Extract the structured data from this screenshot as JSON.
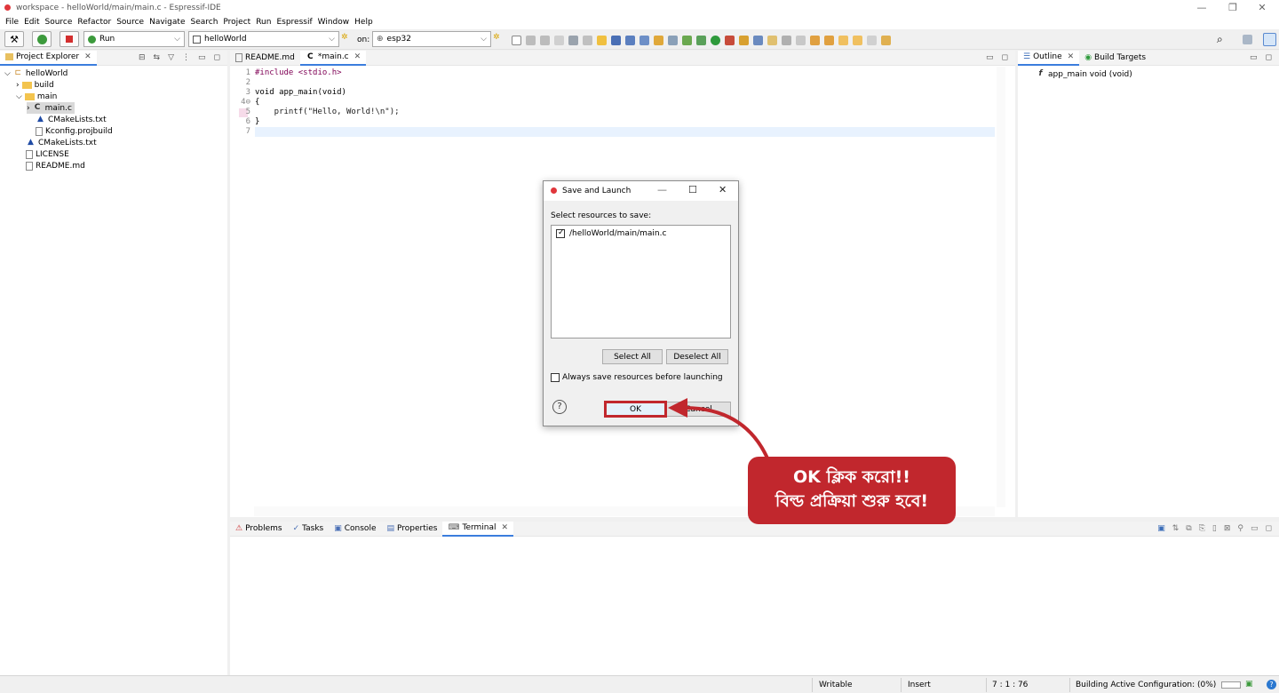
{
  "window": {
    "title": "workspace - helloWorld/main/main.c - Espressif-IDE",
    "controls": [
      "—",
      "❐",
      "✕"
    ]
  },
  "menu": [
    "File",
    "Edit",
    "Source",
    "Refactor",
    "Source",
    "Navigate",
    "Search",
    "Project",
    "Run",
    "Espressif",
    "Window",
    "Help"
  ],
  "toolbar": {
    "launch_mode": "Run",
    "launch_config": "helloWorld",
    "on_label": "on:",
    "target": "esp32"
  },
  "project_explorer": {
    "tab_label": "Project Explorer",
    "items": [
      {
        "label": "helloWorld",
        "icon": "project-icon"
      },
      {
        "label": "build",
        "icon": "folder-icon"
      },
      {
        "label": "main",
        "icon": "folder-icon"
      },
      {
        "label": "main.c",
        "icon": "c-file-icon"
      },
      {
        "label": "CMakeLists.txt",
        "icon": "cmake-icon"
      },
      {
        "label": "Kconfig.projbuild",
        "icon": "file-icon"
      },
      {
        "label": "CMakeLists.txt",
        "icon": "cmake-icon"
      },
      {
        "label": "LICENSE",
        "icon": "license-icon"
      },
      {
        "label": "README.md",
        "icon": "file-icon"
      }
    ]
  },
  "editor": {
    "tabs": [
      {
        "label": "README.md"
      },
      {
        "label": "*main.c"
      }
    ],
    "line_numbers": [
      "1",
      "2",
      "3",
      "4⊖",
      "5",
      "6",
      "7"
    ],
    "lines": [
      "#include <stdio.h>",
      "",
      "void app_main(void)",
      "{",
      "    printf(\"Hello, World!\\n\");",
      "}",
      ""
    ]
  },
  "outline": {
    "tabs": [
      {
        "label": "Outline"
      },
      {
        "label": "Build Targets"
      }
    ],
    "items": [
      {
        "label": "app_main void (void)"
      }
    ]
  },
  "bottom_panel": {
    "tabs": [
      {
        "label": "Problems"
      },
      {
        "label": "Tasks"
      },
      {
        "label": "Console"
      },
      {
        "label": "Properties"
      },
      {
        "label": "Terminal"
      }
    ]
  },
  "dialog": {
    "title": "Save and Launch",
    "prompt": "Select resources to save:",
    "resources": [
      {
        "path": "/helloWorld/main/main.c",
        "checked": true
      }
    ],
    "select_all": "Select All",
    "deselect_all": "Deselect All",
    "always_save": "Always save resources before launching",
    "ok": "OK",
    "cancel": "Cancel",
    "help": "?"
  },
  "callout": {
    "line1": "OK ক্লিক করো!!",
    "line2": "বিল্ড প্রক্রিয়া শুরু হবে!"
  },
  "status": {
    "writable": "Writable",
    "insert": "Insert",
    "position": "7 : 1 : 76",
    "build": "Building Active Configuration: (0%)"
  },
  "colors": {
    "accent": "#3b7ddd",
    "callout": "#c1272d",
    "current_line": "#e8f2fe"
  }
}
